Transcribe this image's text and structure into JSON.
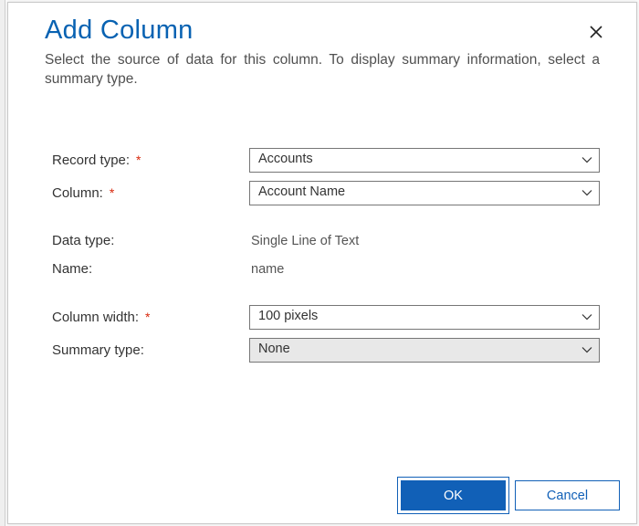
{
  "dialog": {
    "title": "Add Column",
    "subtitle": "Select the source of data for this column. To display summary information, select a summary type."
  },
  "form": {
    "record_type": {
      "label": "Record type:",
      "required": true,
      "value": "Accounts"
    },
    "column": {
      "label": "Column:",
      "required": true,
      "value": "Account Name"
    },
    "data_type": {
      "label": "Data type:",
      "value": "Single Line of Text"
    },
    "name": {
      "label": "Name:",
      "value": "name"
    },
    "column_width": {
      "label": "Column width:",
      "required": true,
      "value": "100 pixels"
    },
    "summary_type": {
      "label": "Summary type:",
      "value": "None",
      "disabled": true
    }
  },
  "buttons": {
    "ok": "OK",
    "cancel": "Cancel"
  }
}
